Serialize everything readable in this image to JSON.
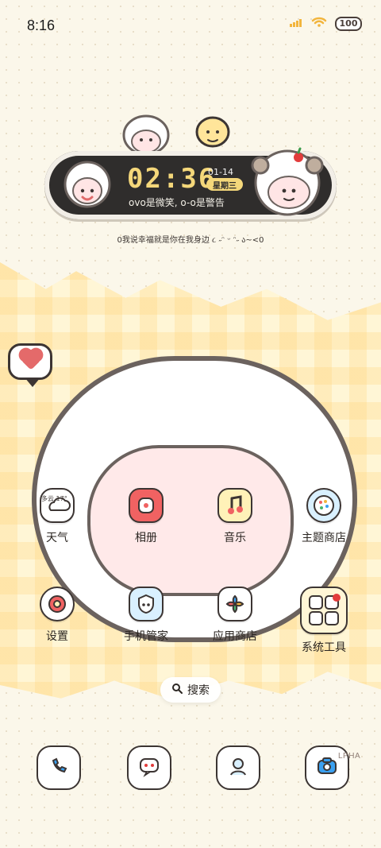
{
  "status_bar": {
    "time": "8:16",
    "battery": "100",
    "icons": [
      "signal-icon",
      "wifi-icon"
    ]
  },
  "clock_widget": {
    "time": "02:36",
    "date": "01-14",
    "weekday": "星期三",
    "motto": "ovo是微笑, o-o是警告"
  },
  "tagline": "0我说幸福就是你在我身边 ૮ ˶ᵔ ᵕ ᵔ˶ ა~<0",
  "apps": [
    {
      "label": "天气",
      "icon": "weather-icon",
      "badge": "多云 17°"
    },
    {
      "label": "相册",
      "icon": "gallery-icon"
    },
    {
      "label": "音乐",
      "icon": "music-icon"
    },
    {
      "label": "主题商店",
      "icon": "theme-store-icon"
    },
    {
      "label": "设置",
      "icon": "settings-icon"
    },
    {
      "label": "手机管家",
      "icon": "phone-manager-icon"
    },
    {
      "label": "应用商店",
      "icon": "app-store-icon"
    },
    {
      "label": "系统工具",
      "icon": "system-tools-icon"
    }
  ],
  "search": {
    "label": "搜索"
  },
  "dock": {
    "items": [
      {
        "icon": "phone-icon"
      },
      {
        "icon": "messages-icon"
      },
      {
        "icon": "contacts-icon"
      },
      {
        "icon": "camera-icon"
      }
    ],
    "lpha": "LPHA"
  }
}
